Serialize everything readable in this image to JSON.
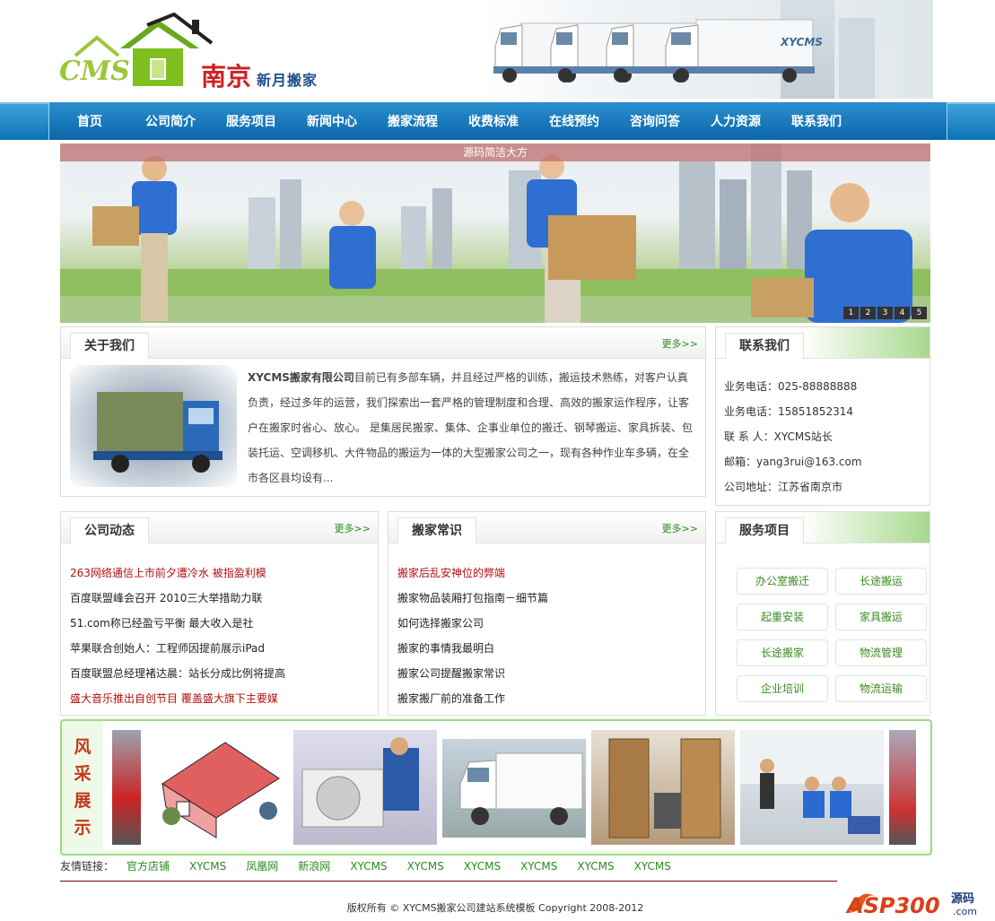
{
  "header": {
    "logo_cms": "CMS",
    "logo_city": "南京",
    "logo_sub": "新月搬家",
    "truck_brand": "XYCMS"
  },
  "nav": {
    "items": [
      "首页",
      "公司简介",
      "服务项目",
      "新闻中心",
      "搬家流程",
      "收费标准",
      "在线预约",
      "咨询问答",
      "人力资源",
      "联系我们"
    ]
  },
  "banner": {
    "caption": "源码简洁大方",
    "dots": [
      "1",
      "2",
      "3",
      "4",
      "5"
    ]
  },
  "about": {
    "title": "关于我们",
    "more": "更多>>",
    "company_name": "XYCMS搬家有限公司",
    "text": "目前已有多部车辆，并且经过严格的训练，搬运技术熟练，对客户认真负责，经过多年的运营，我们探索出一套严格的管理制度和合理、高效的搬家运作程序，让客户在搬家时省心、放心。 是集居民搬家、集体、企事业单位的搬迁、钢琴搬运、家具拆装、包装托运、空调移机、大件物品的搬运为一体的大型搬家公司之一，现有各种作业车多辆，在全市各区县均设有..."
  },
  "contact": {
    "title": "联系我们",
    "lines": [
      "业务电话：025-88888888",
      "业务电话：15851852314",
      "联 系 人：XYCMS站长",
      "邮箱：yang3rui@163.com",
      "公司地址：江苏省南京市"
    ]
  },
  "news": {
    "title": "公司动态",
    "more": "更多>>",
    "items": [
      {
        "text": "263网络通信上市前夕遭冷水 被指盈利模",
        "red": true
      },
      {
        "text": "百度联盟峰会召开 2010三大举措助力联",
        "red": false
      },
      {
        "text": "51.com称已经盈亏平衡 最大收入是社",
        "red": false
      },
      {
        "text": "苹果联合创始人：工程师因提前展示iPad",
        "red": false
      },
      {
        "text": "百度联盟总经理褚达晨：站长分成比例将提高",
        "red": false
      },
      {
        "text": "盛大音乐推出自创节目 覆盖盛大旗下主要媒",
        "red": true
      }
    ]
  },
  "tips": {
    "title": "搬家常识",
    "more": "更多>>",
    "items": [
      {
        "text": "搬家后乱安神位的弊端",
        "red": true
      },
      {
        "text": "搬家物品装厢打包指南－细节篇",
        "red": false
      },
      {
        "text": "如何选择搬家公司",
        "red": false
      },
      {
        "text": "搬家的事情我最明白",
        "red": false
      },
      {
        "text": "搬家公司提醒搬家常识",
        "red": false
      },
      {
        "text": "搬家搬厂前的准备工作",
        "red": false
      }
    ]
  },
  "services": {
    "title": "服务项目",
    "items": [
      "办公室搬迁",
      "长途搬运",
      "起重安装",
      "家具搬运",
      "长途搬家",
      "物流管理",
      "企业培训",
      "物流运输"
    ]
  },
  "gallery": {
    "title": [
      "风",
      "采",
      "展",
      "示"
    ]
  },
  "links": {
    "label": "友情链接：",
    "items": [
      "官方店铺",
      "XYCMS",
      "凤凰网",
      "新浪网",
      "XYCMS",
      "XYCMS",
      "XYCMS",
      "XYCMS",
      "XYCMS",
      "XYCMS",
      "XYCMS"
    ]
  },
  "footer": {
    "copyright": "版权所有 © XYCMS搬家公司建站系统模板  Copyright 2008-2012",
    "watermark": "ASP300源码"
  },
  "colors": {
    "nav_blue": "#0b73b8",
    "accent_green": "#2a8a1f",
    "news_red": "#b01010"
  }
}
